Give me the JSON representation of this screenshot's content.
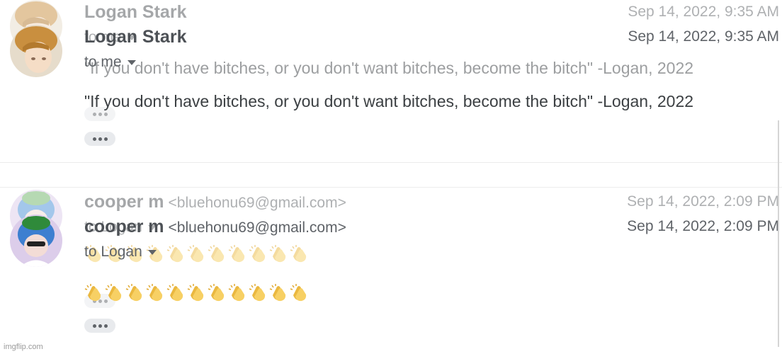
{
  "emails": [
    {
      "sender_name": "Logan Stark",
      "sender_email": "",
      "date": "Sep 14, 2022, 9:35 AM",
      "recipient": "to me",
      "body": "\"If you don't have bitches, or you don't want bitches, become the bitch\" -Logan, 2022",
      "avatar": "logan-avatar"
    },
    {
      "sender_name": "cooper m",
      "sender_email": "<bluehonu69@gmail.com>",
      "date": "Sep 14, 2022, 2:09 PM",
      "recipient": "to Logan",
      "body_emoji": "clapping-hands-emoji",
      "body_emoji_count": 11,
      "avatar": "cooper-avatar"
    }
  ],
  "watermark": "imgflip.com",
  "colors": {
    "sender": "#4d5156",
    "meta": "#5f6368",
    "pill": "#e8eaed",
    "clap": "#f7d064"
  }
}
